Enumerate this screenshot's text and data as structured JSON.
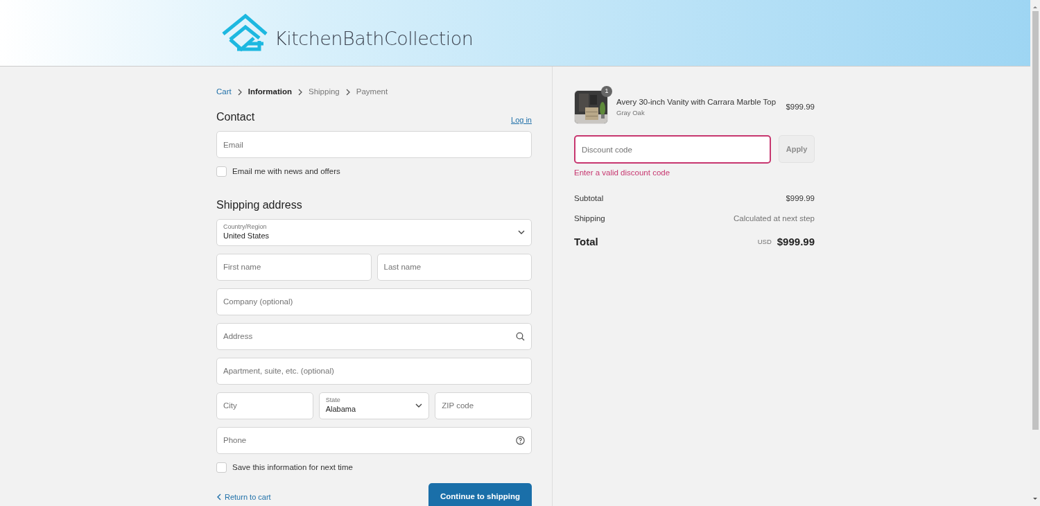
{
  "header": {
    "logo_text": "KitchenBathCollection"
  },
  "breadcrumb": [
    {
      "label": "Cart",
      "completed": true,
      "selected": false
    },
    {
      "label": "Information",
      "completed": false,
      "selected": true
    },
    {
      "label": "Shipping",
      "completed": false,
      "selected": false
    },
    {
      "label": "Payment",
      "completed": false,
      "selected": false
    }
  ],
  "contact": {
    "title": "Contact",
    "login_link": "Log in",
    "email": {
      "placeholder": "Email"
    },
    "newsletter": {
      "label": "Email me with news and offers",
      "checked": false
    }
  },
  "shipping": {
    "title": "Shipping address",
    "rows": [
      [
        {
          "kind": "select",
          "label": "Country/Region",
          "value": "United States"
        }
      ],
      [
        {
          "kind": "text",
          "placeholder": "First name"
        },
        {
          "kind": "text",
          "placeholder": "Last name"
        }
      ],
      [
        {
          "kind": "text",
          "placeholder": "Company (optional)"
        }
      ],
      [
        {
          "kind": "search",
          "placeholder": "Address"
        }
      ],
      [
        {
          "kind": "text",
          "placeholder": "Apartment, suite, etc. (optional)"
        }
      ],
      [
        {
          "kind": "text",
          "placeholder": "City"
        },
        {
          "kind": "select",
          "label": "State",
          "value": "Alabama"
        },
        {
          "kind": "text",
          "placeholder": "ZIP code"
        }
      ],
      [
        {
          "kind": "help",
          "placeholder": "Phone"
        }
      ]
    ]
  },
  "save_info": {
    "label": "Save this information for next time",
    "checked": false
  },
  "actions": {
    "return_link": "Return to cart",
    "continue_button": "Continue to shipping"
  },
  "summary": {
    "items": [
      {
        "name": "Avery 30-inch Vanity with Carrara Marble Top",
        "variant": "Gray Oak",
        "price": "$999.99",
        "quantity": "1"
      }
    ],
    "discount": {
      "placeholder": "Discount code",
      "invalid": true,
      "error": "Enter a valid discount code",
      "button": "Apply",
      "button_disabled": true
    },
    "lines": [
      {
        "label": "Subtotal",
        "value": "$999.99",
        "muted": false
      },
      {
        "label": "Shipping",
        "value": "Calculated at next step",
        "muted": true
      }
    ],
    "total": {
      "label": "Total",
      "currency": "USD",
      "amount": "$999.99"
    }
  }
}
